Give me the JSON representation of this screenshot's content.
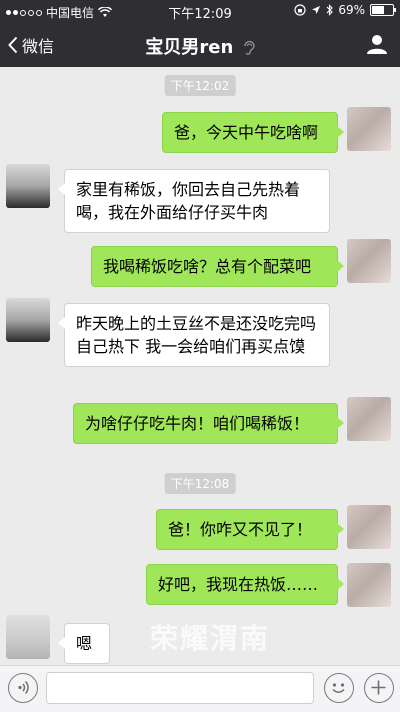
{
  "status_bar": {
    "carrier": "中国电信",
    "time": "下午12:09",
    "battery": "69%",
    "battery_level": 0.69
  },
  "nav": {
    "back_label": "微信",
    "title": "宝贝男ren"
  },
  "messages": [
    {
      "type": "time",
      "text": "下午12:02"
    },
    {
      "type": "me",
      "text": "爸，今天中午吃啥啊"
    },
    {
      "type": "them",
      "text": "家里有稀饭，你回去自己先热着喝，我在外面给仔仔买牛肉"
    },
    {
      "type": "me",
      "text": "我喝稀饭吃啥？总有个配菜吧"
    },
    {
      "type": "them",
      "text": "昨天晚上的土豆丝不是还没吃完吗 自己热下 我一会给咱们再买点馍"
    },
    {
      "type": "me",
      "text": "为啥仔仔吃牛肉！咱们喝稀饭！"
    },
    {
      "type": "time",
      "text": "下午12:08"
    },
    {
      "type": "me",
      "text": "爸！你咋又不见了！"
    },
    {
      "type": "me",
      "text": "好吧，我现在热饭……"
    },
    {
      "type": "them",
      "text": "嗯"
    }
  ],
  "watermark": "荣耀渭南",
  "input_bar": {
    "value": ""
  }
}
